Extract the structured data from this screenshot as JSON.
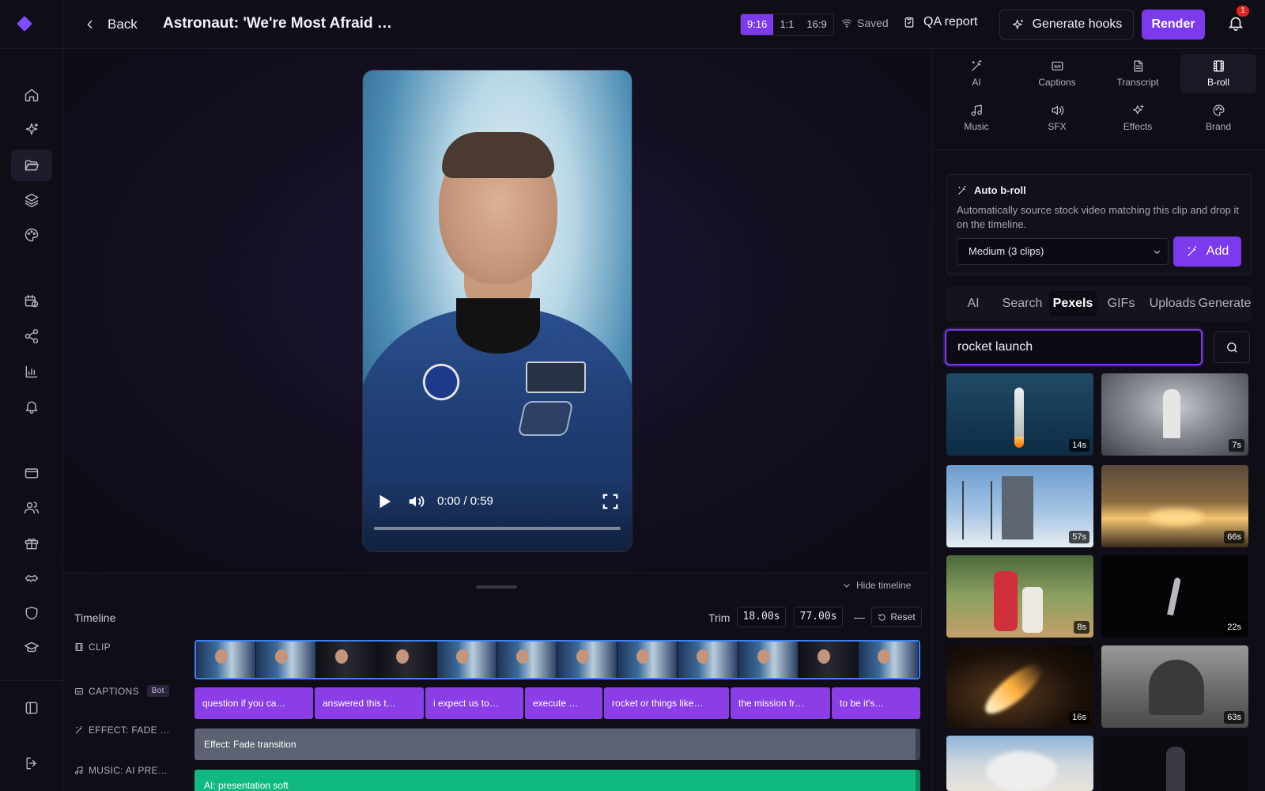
{
  "topbar": {
    "back_label": "Back",
    "title": "Astronaut: 'We're Most Afraid of M…",
    "ratios": [
      "9:16",
      "1:1",
      "16:9"
    ],
    "selected_ratio": "9:16",
    "saved_label": "Saved",
    "qa_label": "QA report",
    "generate_hooks_label": "Generate hooks",
    "render_label": "Render",
    "notification_count": "1"
  },
  "player": {
    "time": "0:00 / 0:59",
    "progress": 0
  },
  "timeline": {
    "title": "Timeline",
    "hide_label": "Hide timeline",
    "trim_label": "Trim",
    "trim_start": "18.00s",
    "trim_sep": "—",
    "trim_end": "77.00s",
    "reset_label": "Reset",
    "lanes": {
      "clip": "CLIP",
      "captions": "CAPTIONS",
      "captions_badge": "Bot",
      "effect": "EFFECT: FADE …",
      "music": "MUSIC: AI PRE…"
    },
    "captions": [
      "question if you ca…",
      "answered this t…",
      "i expect us to…",
      "execute …",
      "rocket or things like…",
      "the mission fr…",
      "to be it's…"
    ],
    "effect_segment": "Effect: Fade transition",
    "music_segment": "AI: presentation soft"
  },
  "panel": {
    "tabs": [
      "AI",
      "Captions",
      "Transcript",
      "B-roll",
      "Music",
      "SFX",
      "Effects",
      "Brand"
    ],
    "selected_tab": "B-roll",
    "auto_broll": {
      "title": "Auto b-roll",
      "description": "Automatically source stock video matching this clip and drop it on the timeline.",
      "select_value": "Medium (3 clips)",
      "add_label": "Add"
    },
    "source_tabs": [
      "AI",
      "Search",
      "Pexels",
      "GIFs",
      "Uploads",
      "Generate"
    ],
    "selected_source": "Pexels",
    "search_value": "rocket launch",
    "results": [
      {
        "duration": "14s"
      },
      {
        "duration": "7s"
      },
      {
        "duration": "57s"
      },
      {
        "duration": "66s"
      },
      {
        "duration": "8s"
      },
      {
        "duration": "22s"
      },
      {
        "duration": "16s"
      },
      {
        "duration": "63s"
      },
      {
        "duration": ""
      },
      {
        "duration": ""
      }
    ]
  },
  "colors": {
    "accent": "#7c3aed",
    "clip_border": "#3b82f6",
    "captions": "#8b3ee6",
    "effect": "#5c6272",
    "music": "#10b981"
  }
}
